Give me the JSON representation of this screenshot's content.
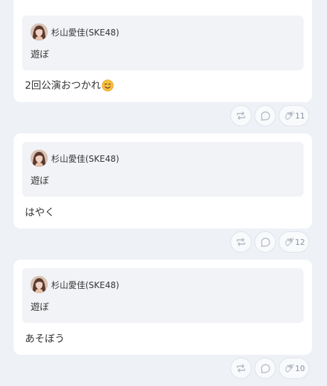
{
  "posts": [
    {
      "quote": {
        "author": "杉山愛佳(SKE48)",
        "text": "遊ぼ",
        "avatar_icon": "avatar-photo"
      },
      "text": "2回公演おつかれ",
      "emoji": "😊",
      "actions": {
        "repost_icon": "repost-icon",
        "comment_icon": "comment-icon",
        "like_icon": "clap-icon",
        "likes": "11"
      }
    },
    {
      "quote": {
        "author": "杉山愛佳(SKE48)",
        "text": "遊ぼ",
        "avatar_icon": "avatar-photo"
      },
      "text": "はやく",
      "emoji": "",
      "actions": {
        "repost_icon": "repost-icon",
        "comment_icon": "comment-icon",
        "like_icon": "clap-icon",
        "likes": "12"
      }
    },
    {
      "quote": {
        "author": "杉山愛佳(SKE48)",
        "text": "遊ぼ",
        "avatar_icon": "avatar-photo"
      },
      "text": "あそぼう",
      "emoji": "",
      "actions": {
        "repost_icon": "repost-icon",
        "comment_icon": "comment-icon",
        "like_icon": "clap-icon",
        "likes": "10"
      }
    }
  ],
  "colors": {
    "background": "#eef1f6",
    "card": "#ffffff",
    "quote_bg": "#f1f3f6",
    "icon": "#b4bac4"
  }
}
